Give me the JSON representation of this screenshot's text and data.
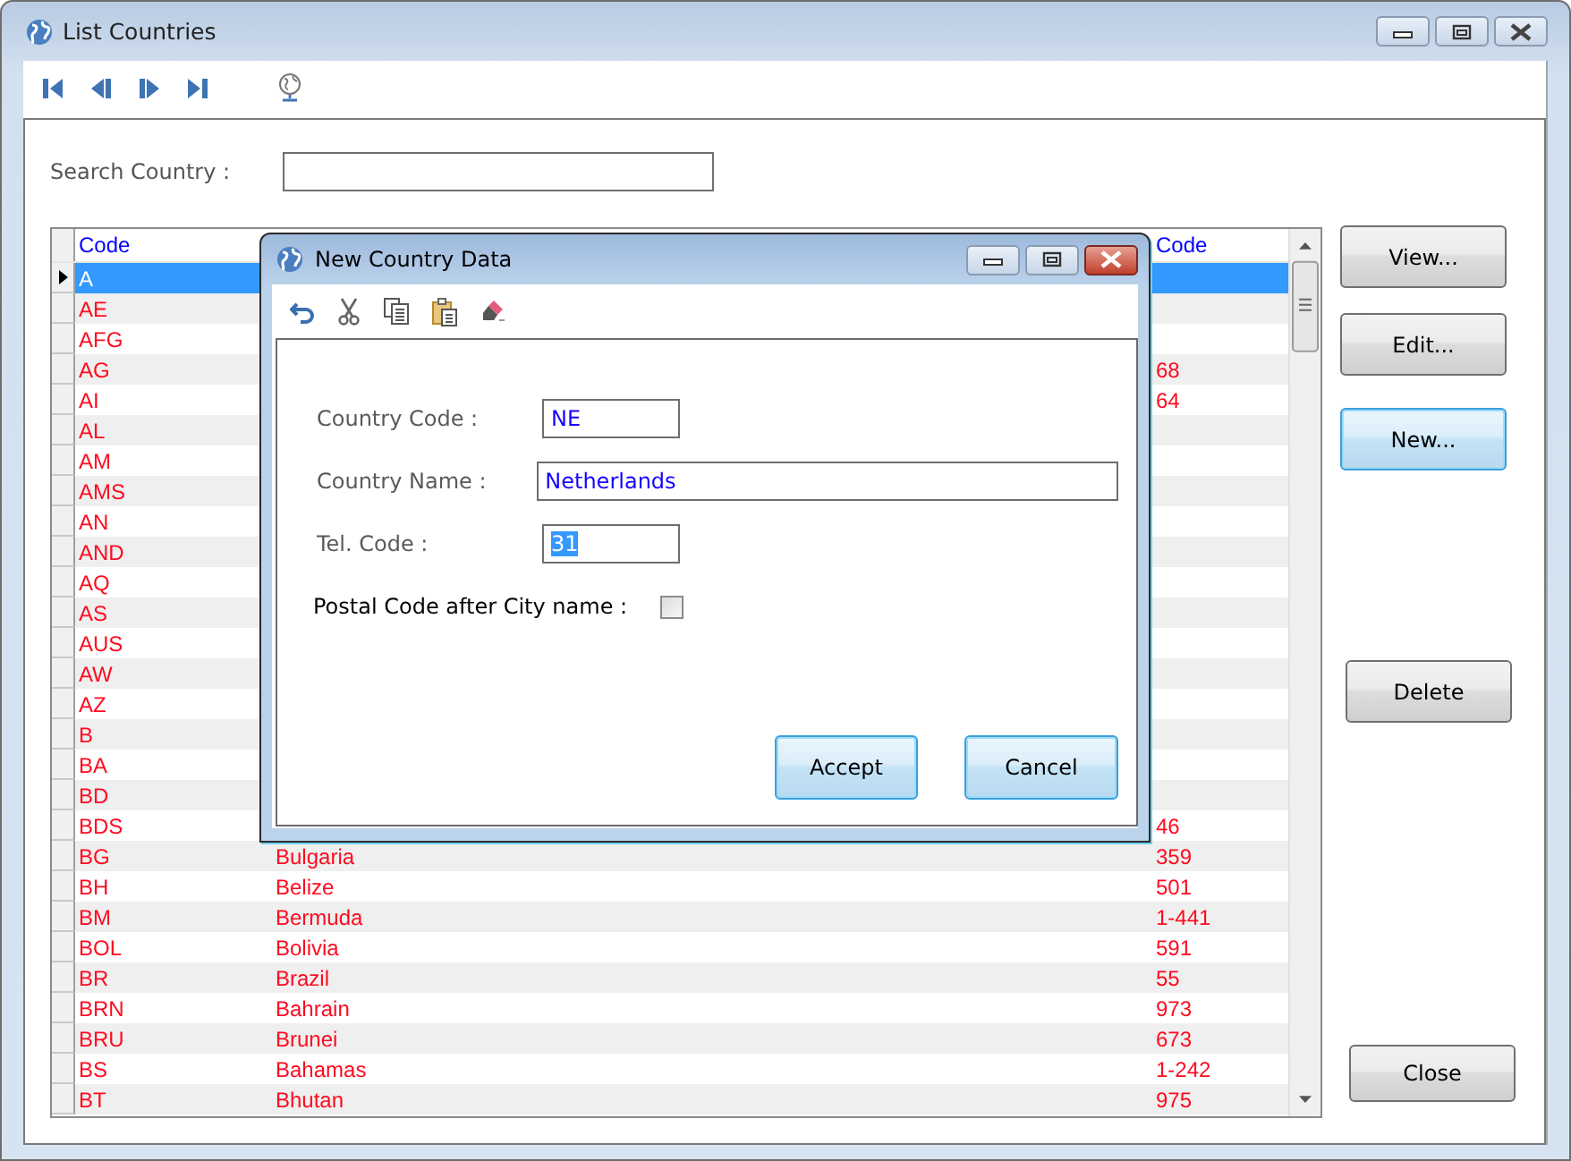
{
  "window": {
    "title": "List Countries"
  },
  "search": {
    "label": "Search Country :"
  },
  "grid": {
    "columns": {
      "code": "Code",
      "column_3": "Code"
    },
    "rows": [
      {
        "code": "A",
        "selected": true
      },
      {
        "code": "AE",
        "selected": false
      },
      {
        "code": "AFG",
        "selected": false
      },
      {
        "code": "AG",
        "column_3": "68",
        "selected": false
      },
      {
        "code": "AI",
        "column_3": "64",
        "selected": false
      },
      {
        "code": "AL",
        "selected": false
      },
      {
        "code": "AM",
        "selected": false
      },
      {
        "code": "AMS",
        "selected": false
      },
      {
        "code": "AN",
        "selected": false
      },
      {
        "code": "AND",
        "selected": false
      },
      {
        "code": "AQ",
        "selected": false
      },
      {
        "code": "AS",
        "selected": false
      },
      {
        "code": "AUS",
        "selected": false
      },
      {
        "code": "AW",
        "selected": false
      },
      {
        "code": "AZ",
        "selected": false
      },
      {
        "code": "B",
        "selected": false
      },
      {
        "code": "BA",
        "selected": false
      },
      {
        "code": "BD",
        "selected": false
      },
      {
        "code": "BDS",
        "column_3": "46",
        "selected": false
      },
      {
        "code": "BG",
        "name": "Bulgaria",
        "column_3": "359",
        "selected": false
      },
      {
        "code": "BH",
        "name": "Belize",
        "column_3": "501",
        "selected": false
      },
      {
        "code": "BM",
        "name": "Bermuda",
        "column_3": "1-441",
        "selected": false
      },
      {
        "code": "BOL",
        "name": "Bolivia",
        "column_3": "591",
        "selected": false
      },
      {
        "code": "BR",
        "name": "Brazil",
        "column_3": "55",
        "selected": false
      },
      {
        "code": "BRN",
        "name": "Bahrain",
        "column_3": "973",
        "selected": false
      },
      {
        "code": "BRU",
        "name": "Brunei",
        "column_3": "673",
        "selected": false
      },
      {
        "code": "BS",
        "name": "Bahamas",
        "column_3": "1-242",
        "selected": false
      },
      {
        "code": "BT",
        "name": "Bhutan",
        "column_3": "975",
        "selected": false
      }
    ]
  },
  "buttons": [
    {
      "label": "View...",
      "focused": false
    },
    {
      "label": "Edit...",
      "focused": false
    },
    {
      "label": "New...",
      "focused": true
    },
    {
      "label": "Delete",
      "focused": false
    },
    {
      "label": "Close",
      "focused": false
    }
  ],
  "dialog": {
    "title": "New Country Data",
    "fields": [
      {
        "label": "Country Code :",
        "value": "NE",
        "kind": "short",
        "text_selected": false
      },
      {
        "label": "Country Name :",
        "value": "Netherlands",
        "kind": "long",
        "text_selected": false
      },
      {
        "label": "Tel. Code :",
        "value": "31",
        "kind": "short",
        "text_selected": true
      }
    ],
    "checkbox": {
      "label": "Postal Code after City name :",
      "checked": false
    },
    "buttons": [
      "Accept",
      "Cancel"
    ]
  }
}
